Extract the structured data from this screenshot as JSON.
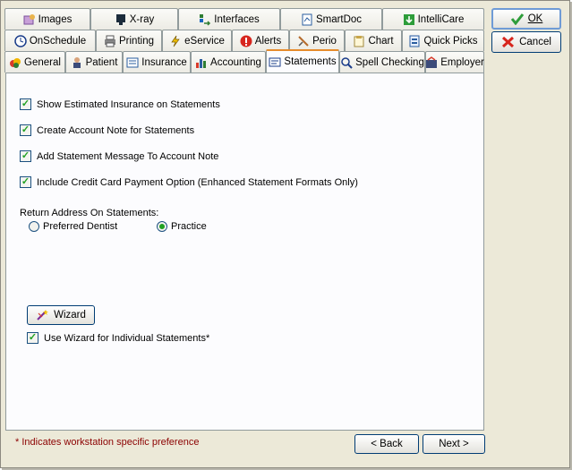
{
  "tabs": {
    "row1": [
      {
        "label": "Images",
        "icon": "images-icon"
      },
      {
        "label": "X-ray",
        "icon": "xray-icon"
      },
      {
        "label": "Interfaces",
        "icon": "interfaces-icon"
      },
      {
        "label": "SmartDoc",
        "icon": "smartdoc-icon"
      },
      {
        "label": "IntelliCare",
        "icon": "intellicare-icon"
      }
    ],
    "row2": [
      {
        "label": "OnSchedule",
        "icon": "clock-icon"
      },
      {
        "label": "Printing",
        "icon": "printer-icon"
      },
      {
        "label": "eService",
        "icon": "lightning-icon"
      },
      {
        "label": "Alerts",
        "icon": "alert-icon"
      },
      {
        "label": "Perio",
        "icon": "perio-icon"
      },
      {
        "label": "Chart",
        "icon": "chart-icon"
      },
      {
        "label": "Quick Picks",
        "icon": "quickpicks-icon"
      }
    ],
    "row3": [
      {
        "label": "General",
        "icon": "general-icon"
      },
      {
        "label": "Patient",
        "icon": "patient-icon"
      },
      {
        "label": "Insurance",
        "icon": "insurance-icon"
      },
      {
        "label": "Accounting",
        "icon": "accounting-icon"
      },
      {
        "label": "Statements",
        "icon": "statements-icon",
        "active": true
      },
      {
        "label": "Spell Checking",
        "icon": "spellcheck-icon"
      },
      {
        "label": "Employer",
        "icon": "employer-icon"
      }
    ]
  },
  "buttons": {
    "ok": "OK",
    "cancel": "Cancel",
    "wizard": "Wizard",
    "back": "< Back",
    "next": "Next >"
  },
  "options": {
    "show_estimated": {
      "label": "Show Estimated Insurance on Statements",
      "checked": true
    },
    "create_note": {
      "label": "Create Account Note for Statements",
      "checked": true
    },
    "add_message": {
      "label": "Add Statement Message To Account Note",
      "checked": true
    },
    "credit_card": {
      "label": "Include Credit Card Payment Option (Enhanced Statement Formats Only)",
      "checked": true
    },
    "use_wizard": {
      "label": "Use Wizard for Individual Statements*",
      "checked": true
    }
  },
  "return_address": {
    "label": "Return Address On Statements:",
    "preferred_dentist": "Preferred Dentist",
    "practice": "Practice",
    "selected": "Practice"
  },
  "footnote": "* Indicates workstation specific preference",
  "colors": {
    "active_tab_accent": "#e68b2c",
    "check": "#21a121",
    "footnote": "#8b0000"
  }
}
